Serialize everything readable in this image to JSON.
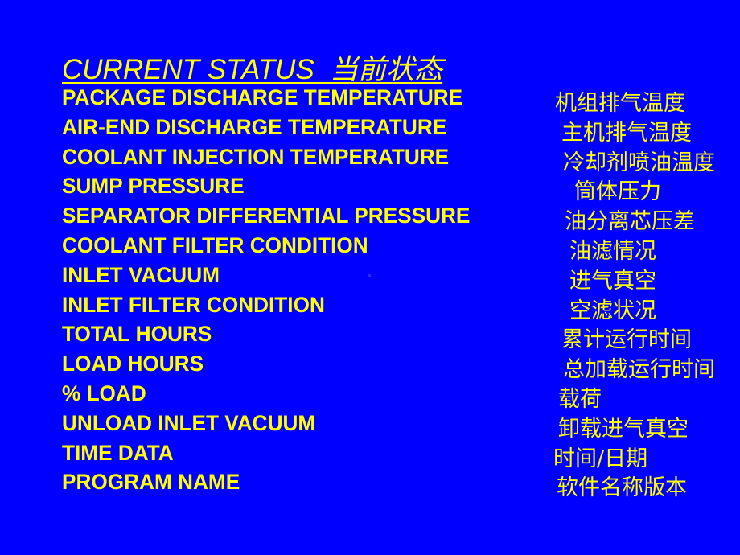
{
  "title": "CURRENT STATUS  当前状态",
  "items": [
    {
      "en": "PACKAGE DISCHARGE TEMPERATURE",
      "zh": "机组排气温度"
    },
    {
      "en": "AIR-END DISCHARGE TEMPERATURE",
      "zh": "主机排气温度"
    },
    {
      "en": "COOLANT INJECTION TEMPERATURE",
      "zh": "冷却剂喷油温度"
    },
    {
      "en": "SUMP PRESSURE",
      "zh": "筒体压力"
    },
    {
      "en": "SEPARATOR DIFFERENTIAL PRESSURE",
      "zh": "油分离芯压差"
    },
    {
      "en": "COOLANT FILTER CONDITION",
      "zh": "油滤情况"
    },
    {
      "en": "INLET VACUUM",
      "zh": "进气真空"
    },
    {
      "en": "INLET FILTER CONDITION",
      "zh": "空滤状况"
    },
    {
      "en": "TOTAL HOURS",
      "zh": "累计运行时间"
    },
    {
      "en": "LOAD HOURS",
      "zh": "总加载运行时间"
    },
    {
      "en": "% LOAD",
      "zh": "载荷"
    },
    {
      "en": "UNLOAD INLET VACUUM",
      "zh": "卸载进气真空"
    },
    {
      "en": "TIME DATA",
      "zh": "时间/日期"
    },
    {
      "en": "PROGRAM NAME",
      "zh": "软件名称版本"
    }
  ],
  "colors": {
    "background": "#0000FF",
    "text": "#FFFF00"
  }
}
